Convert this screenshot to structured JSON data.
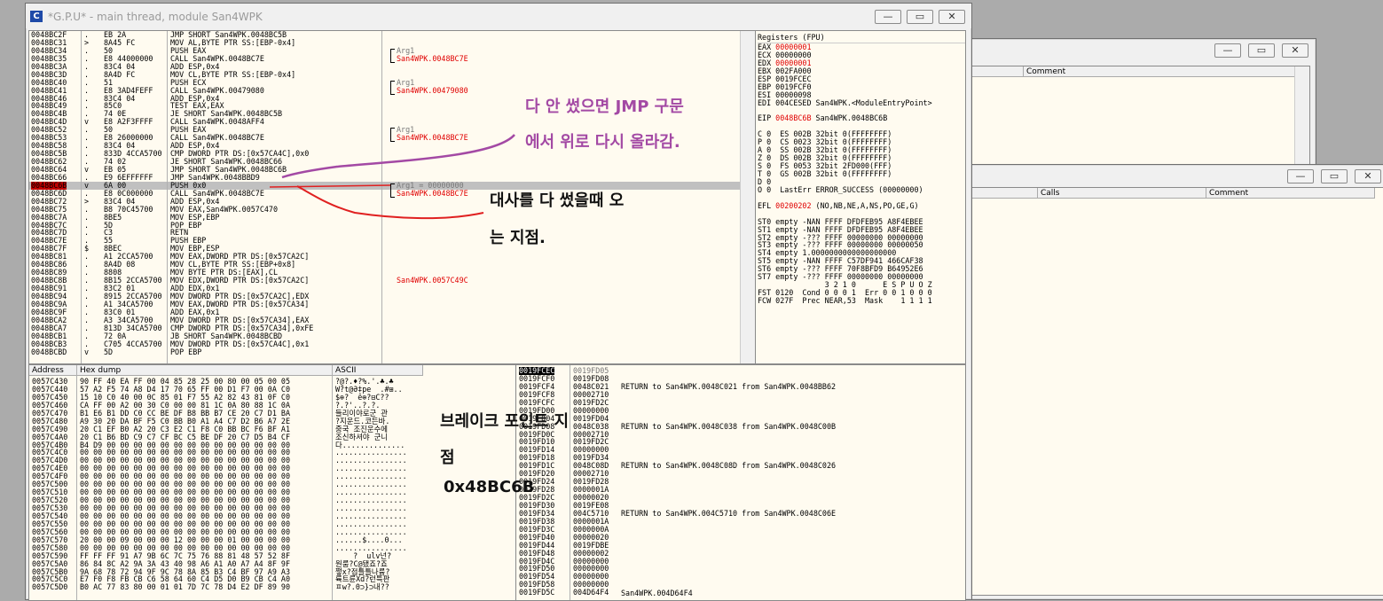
{
  "main_window": {
    "title": "*G.P.U* - main thread, module San4WPK",
    "app_icon_letter": "C",
    "buttons": {
      "minimize": "—",
      "maximize": "▭",
      "close": "✕"
    }
  },
  "disasm": {
    "addresses": [
      "0048BC2F",
      "0048BC31",
      "0048BC34",
      "0048BC35",
      "0048BC3A",
      "0048BC3D",
      "0048BC40",
      "0048BC41",
      "0048BC46",
      "0048BC49",
      "0048BC4B",
      "0048BC4D",
      "0048BC52",
      "0048BC53",
      "0048BC58",
      "0048BC5B",
      "0048BC62",
      "0048BC64",
      "0048BC66",
      "0048BC6B",
      "0048BC6D",
      "0048BC72",
      "0048BC75",
      "0048BC7A",
      "0048BC7C",
      "0048BC7D",
      "0048BC7E",
      "0048BC7F",
      "0048BC81",
      "0048BC86",
      "0048BC89",
      "0048BC8B",
      "0048BC91",
      "0048BC94",
      "0048BC9A",
      "0048BC9F",
      "0048BCA2",
      "0048BCA7",
      "0048BCB1",
      "0048BCB3",
      "0048BCBD"
    ],
    "marks": [
      ".",
      ">",
      ".",
      ".",
      ".",
      ".",
      ".",
      ".",
      ".",
      ".",
      ".",
      "v",
      ".",
      ".",
      ".",
      ".",
      ".",
      "v",
      ".",
      "v",
      ".",
      ">",
      ".",
      ".",
      ".",
      ".",
      ".",
      "$",
      ".",
      ".",
      ".",
      ".",
      ".",
      ".",
      ".",
      ".",
      ".",
      ".",
      ".",
      ".",
      "v",
      "."
    ],
    "hex": [
      "EB 2A",
      "8A45 FC",
      "50",
      "E8 44000000",
      "83C4 04",
      "8A4D FC",
      "51",
      "E8 3AD4FEFF",
      "83C4 04",
      "85C0",
      "74 0E",
      "E8 A2F3FFFF",
      "50",
      "E8 26000000",
      "83C4 04",
      "833D 4CCA5700",
      "74 02",
      "EB 05",
      "E9 6EFFFFFF",
      "6A 00",
      "E8 0C000000",
      "83C4 04",
      "B8 70C45700",
      "8BE5",
      "5D",
      "C3",
      "55",
      "8BEC",
      "A1 2CCA5700",
      "8A4D 08",
      "8808",
      "8B15 2CCA5700",
      "83C2 01",
      "8915 2CCA5700",
      "A1 34CA5700",
      "83C0 01",
      "A3 34CA5700",
      "813D 34CA5700",
      "72 0A",
      "C705 4CCA5700",
      "5D"
    ],
    "asm": [
      "JMP SHORT San4WPK.0048BC5B",
      "MOV AL,BYTE PTR SS:[EBP-0x4]",
      "PUSH EAX",
      "CALL San4WPK.0048BC7E",
      "ADD ESP,0x4",
      "MOV CL,BYTE PTR SS:[EBP-0x4]",
      "PUSH ECX",
      "CALL San4WPK.00479080",
      "ADD ESP,0x4",
      "TEST EAX,EAX",
      "JE SHORT San4WPK.0048BC5B",
      "CALL San4WPK.0048AFF4",
      "PUSH EAX",
      "CALL San4WPK.0048BC7E",
      "ADD ESP,0x4",
      "CMP DWORD PTR DS:[0x57CA4C],0x0",
      "JE SHORT San4WPK.0048BC66",
      "JMP SHORT San4WPK.0048BC6B",
      "JMP San4WPK.0048BBD9",
      "PUSH 0x0",
      "CALL San4WPK.0048BC7E",
      "ADD ESP,0x4",
      "MOV EAX,San4WPK.0057C470",
      "MOV ESP,EBP",
      "POP EBP",
      "RETN",
      "PUSH EBP",
      "MOV EBP,ESP",
      "MOV EAX,DWORD PTR DS:[0x57CA2C]",
      "MOV CL,BYTE PTR SS:[EBP+0x8]",
      "MOV BYTE PTR DS:[EAX],CL",
      "MOV EDX,DWORD PTR DS:[0x57CA2C]",
      "ADD EDX,0x1",
      "MOV DWORD PTR DS:[0x57CA2C],EDX",
      "MOV EAX,DWORD PTR DS:[0x57CA34]",
      "ADD EAX,0x1",
      "MOV DWORD PTR DS:[0x57CA34],EAX",
      "CMP DWORD PTR DS:[0x57CA34],0xFE",
      "JB SHORT San4WPK.0048BCBD",
      "MOV DWORD PTR DS:[0x57CA4C],0x1",
      "POP EBP"
    ],
    "highlight_address": "0048BC6B",
    "comments": [
      {
        "row": 2,
        "lines": [
          "Arg1",
          "San4WPK.0048BC7E"
        ]
      },
      {
        "row": 6,
        "lines": [
          "Arg1",
          "San4WPK.00479080"
        ]
      },
      {
        "row": 12,
        "lines": [
          "Arg1",
          "San4WPK.0048BC7E"
        ]
      },
      {
        "row": 19,
        "lines": [
          "Arg1 = 00000000",
          "San4WPK.0048BC7E"
        ]
      },
      {
        "row": 31,
        "lines": [
          "San4WPK.0057C49C"
        ]
      }
    ]
  },
  "registers": {
    "title": "Registers (FPU)",
    "lines": [
      "EAX 00000001",
      "ECX 00000000",
      "EDX 00000001",
      "EBX 002FA000",
      "ESP 0019FCEC",
      "EBP 0019FCF0",
      "ESI 00000098",
      "EDI 004CESED San4WPK.<ModuleEntryPoint>",
      "",
      "EIP 0048BC6B San4WPK.0048BC6B",
      "",
      "C 0  ES 002B 32bit 0(FFFFFFFF)",
      "P 0  CS 0023 32bit 0(FFFFFFFF)",
      "A 0  SS 002B 32bit 0(FFFFFFFF)",
      "Z 0  DS 002B 32bit 0(FFFFFFFF)",
      "S 0  FS 0053 32bit 2FD000(FFF)",
      "T 0  GS 002B 32bit 0(FFFFFFFF)",
      "D 0",
      "O 0  LastErr ERROR_SUCCESS (00000000)",
      "",
      "EFL 00200202 (NO,NB,NE,A,NS,PO,GE,G)",
      "",
      "ST0 empty -NAN FFFF DFDFEB95 A8F4EBEE",
      "ST1 empty -NAN FFFF DFDFEB95 A8F4EBEE",
      "ST2 empty -??? FFFF 00000000 00000000",
      "ST3 empty -??? FFFF 00000000 00000050",
      "ST4 empty 1.0000000000000000000",
      "ST5 empty -NAN FFFF C57DF941 466CAF38",
      "ST6 empty -??? FFFF 70F8BFD9 B64952E6",
      "ST7 empty -??? FFFF 00000000 00000000",
      "               3 2 1 0      E S P U O Z",
      "FST 0120  Cond 0 0 0 1  Err 0 0 1 0 0 0",
      "FCW 027F  Prec NEAR,53  Mask    1 1 1 1"
    ]
  },
  "dump": {
    "headers": {
      "address": "Address",
      "hex": "Hex dump",
      "ascii": "ASCII"
    },
    "addresses": [
      "0057C430",
      "0057C440",
      "0057C450",
      "0057C460",
      "0057C470",
      "0057C480",
      "0057C490",
      "0057C4A0",
      "0057C4B0",
      "0057C4C0",
      "0057C4D0",
      "0057C4E0",
      "0057C4F0",
      "0057C500",
      "0057C510",
      "0057C520",
      "0057C530",
      "0057C540",
      "0057C550",
      "0057C560",
      "0057C570",
      "0057C580",
      "0057C590",
      "0057C5A0",
      "0057C5B0",
      "0057C5C0",
      "0057C5D0"
    ],
    "hex": [
      "90 FF 40 EA FF 00 04 85 28 25 00 80 00 05 00 05",
      "57 A2 F5 74 A8 D4 17 70 65 FF 00 D1 F7 00 0A C0",
      "15 10 C0 40 00 0C 85 01 F7 55 A2 82 43 81 0F C0",
      "CA FF 00 A2 00 30 C0 00 00 81 1C 0A 80 88 1C 0A",
      "B1 E6 B1 DD C0 CC BE DF B8 BB B7 CE 20 C7 D1 BA",
      "A9 30 20 DA BF F5 C0 BB B0 A1 A4 C7 D2 B6 A7 2E",
      "20 C1 EF B0 A2 20 C3 E2 C1 F8 C0 BB BC F6 BF A1",
      "20 C1 B6 BD C9 C7 CF BC C5 BE DF 20 C7 D5 B4 CF",
      "B4 D9 00 00 00 00 00 00 00 00 00 00 00 00 00 00",
      "00 00 00 00 00 00 00 00 00 00 00 00 00 00 00 00",
      "00 00 00 00 00 00 00 00 00 00 00 00 00 00 00 00",
      "00 00 00 00 00 00 00 00 00 00 00 00 00 00 00 00",
      "00 00 00 00 00 00 00 00 00 00 00 00 00 00 00 00",
      "00 00 00 00 00 00 00 00 00 00 00 00 00 00 00 00",
      "00 00 00 00 00 00 00 00 00 00 00 00 00 00 00 00",
      "00 00 00 00 00 00 00 00 00 00 00 00 00 00 00 00",
      "00 00 00 00 00 00 00 00 00 00 00 00 00 00 00 00",
      "00 00 00 00 00 00 00 00 00 00 00 00 00 00 00 00",
      "00 00 00 00 00 00 00 00 00 00 00 00 00 00 00 00",
      "00 00 00 00 00 00 00 00 00 00 00 00 00 00 00 00",
      "20 00 00 09 00 00 00 12 00 00 00 01 00 00 00 00",
      "00 00 00 00 00 00 00 00 00 00 00 00 00 00 00 00",
      "FF FF FF 91 A7 9B 6C 7C 75 76 88 81 48 57 52 8F",
      "86 84 8C A2 9A 3A 43 40 98 A6 A1 A0 A7 A4 8F 9F",
      "9A 68 78 72 94 9F 9C 78 8A 85 B3 C4 BF 97 A9 A3",
      "E7 F0 F8 FB CB C6 58 64 60 C4 D5 D0 B9 CB C4 A0",
      "B0 AC 77 83 80 00 01 01 7D 7C 78 D4 E2 DF 89 90"
    ],
    "ascii": [
      "?@?.♦?%.'.♣.♣",
      "W?t@Ə‡pe  .#⊞..",
      "$⊕?  ê⊕?⊟C??",
      "?.?'..?.?.",
      "들리이야로군 관",
      "?지운드.코든바.",
      "중국 조진운수에",
      "조신하셔야 군니",
      "다..............",
      "................",
      "................",
      "................",
      "................",
      "................",
      "................",
      "................",
      "................",
      "................",
      "................",
      "................",
      "......$....0...",
      "................",
      "    ?  ulv넌?",
      "원룸?C@됐죠?죠",
      "쩧x?접틀틀나륨?",
      "륙트륜Xd?런특판",
      "ㅍw?.0⊃}⊃내??"
    ]
  },
  "stack": {
    "addresses": [
      "0019FCEC",
      "0019FCF0",
      "0019FCF4",
      "0019FCF8",
      "0019FCFC",
      "0019FD00",
      "0019FD04",
      "0019FD08",
      "0019FD0C",
      "0019FD10",
      "0019FD14",
      "0019FD18",
      "0019FD1C",
      "0019FD20",
      "0019FD24",
      "0019FD28",
      "0019FD2C",
      "0019FD30",
      "0019FD34",
      "0019FD38",
      "0019FD3C",
      "0019FD40",
      "0019FD44",
      "0019FD48",
      "0019FD4C",
      "0019FD50",
      "0019FD54",
      "0019FD58",
      "0019FD5C"
    ],
    "values": [
      "0019FD05",
      "0019FD08",
      "0048C021",
      "00002710",
      "0019FD2C",
      "00000000",
      "0019FD04",
      "0048C038",
      "00002710",
      "0019FD2C",
      "00000000",
      "0019FD34",
      "0048C08D",
      "00002710",
      "0019FD28",
      "0000001A",
      "00000020",
      "0019FE08",
      "004C5710",
      "0000001A",
      "0000000A",
      "00000020",
      "0019FDBE",
      "00000002",
      "00000000",
      "00000000",
      "00000000",
      "00000000",
      "004D64F4"
    ],
    "comments": [
      {
        "row": 2,
        "text": "RETURN to San4WPK.0048C021 from San4WPK.0048BB62"
      },
      {
        "row": 7,
        "text": "RETURN to San4WPK.0048C038 from San4WPK.0048C00B"
      },
      {
        "row": 12,
        "text": "RETURN to San4WPK.0048C08D from San4WPK.0048C026"
      },
      {
        "row": 18,
        "text": "RETURN to San4WPK.004C5710 from San4WPK.0048C06E"
      },
      {
        "row": 28,
        "text": "San4WPK.004D64F4"
      }
    ]
  },
  "bg_window1": {
    "col_comment": "Comment"
  },
  "bg_window2": {
    "col_calls": "Calls",
    "col_comment": "Comment"
  },
  "annotations": {
    "purple_line1": "다 안 썼으면 JMP 구문",
    "purple_line2": "에서 위로 다시 올라감.",
    "red_line1": "대사를 다 썼을때 오",
    "red_line2": "는 지점.",
    "bp_line1": "브레이크 포인트 지",
    "bp_line2": "점",
    "bp_address": "0x48BC6B"
  },
  "colors": {
    "purple": "#a349a4",
    "red": "#e02020",
    "pane_bg": "#fffbf0",
    "highlight": "#c0c0c0"
  }
}
